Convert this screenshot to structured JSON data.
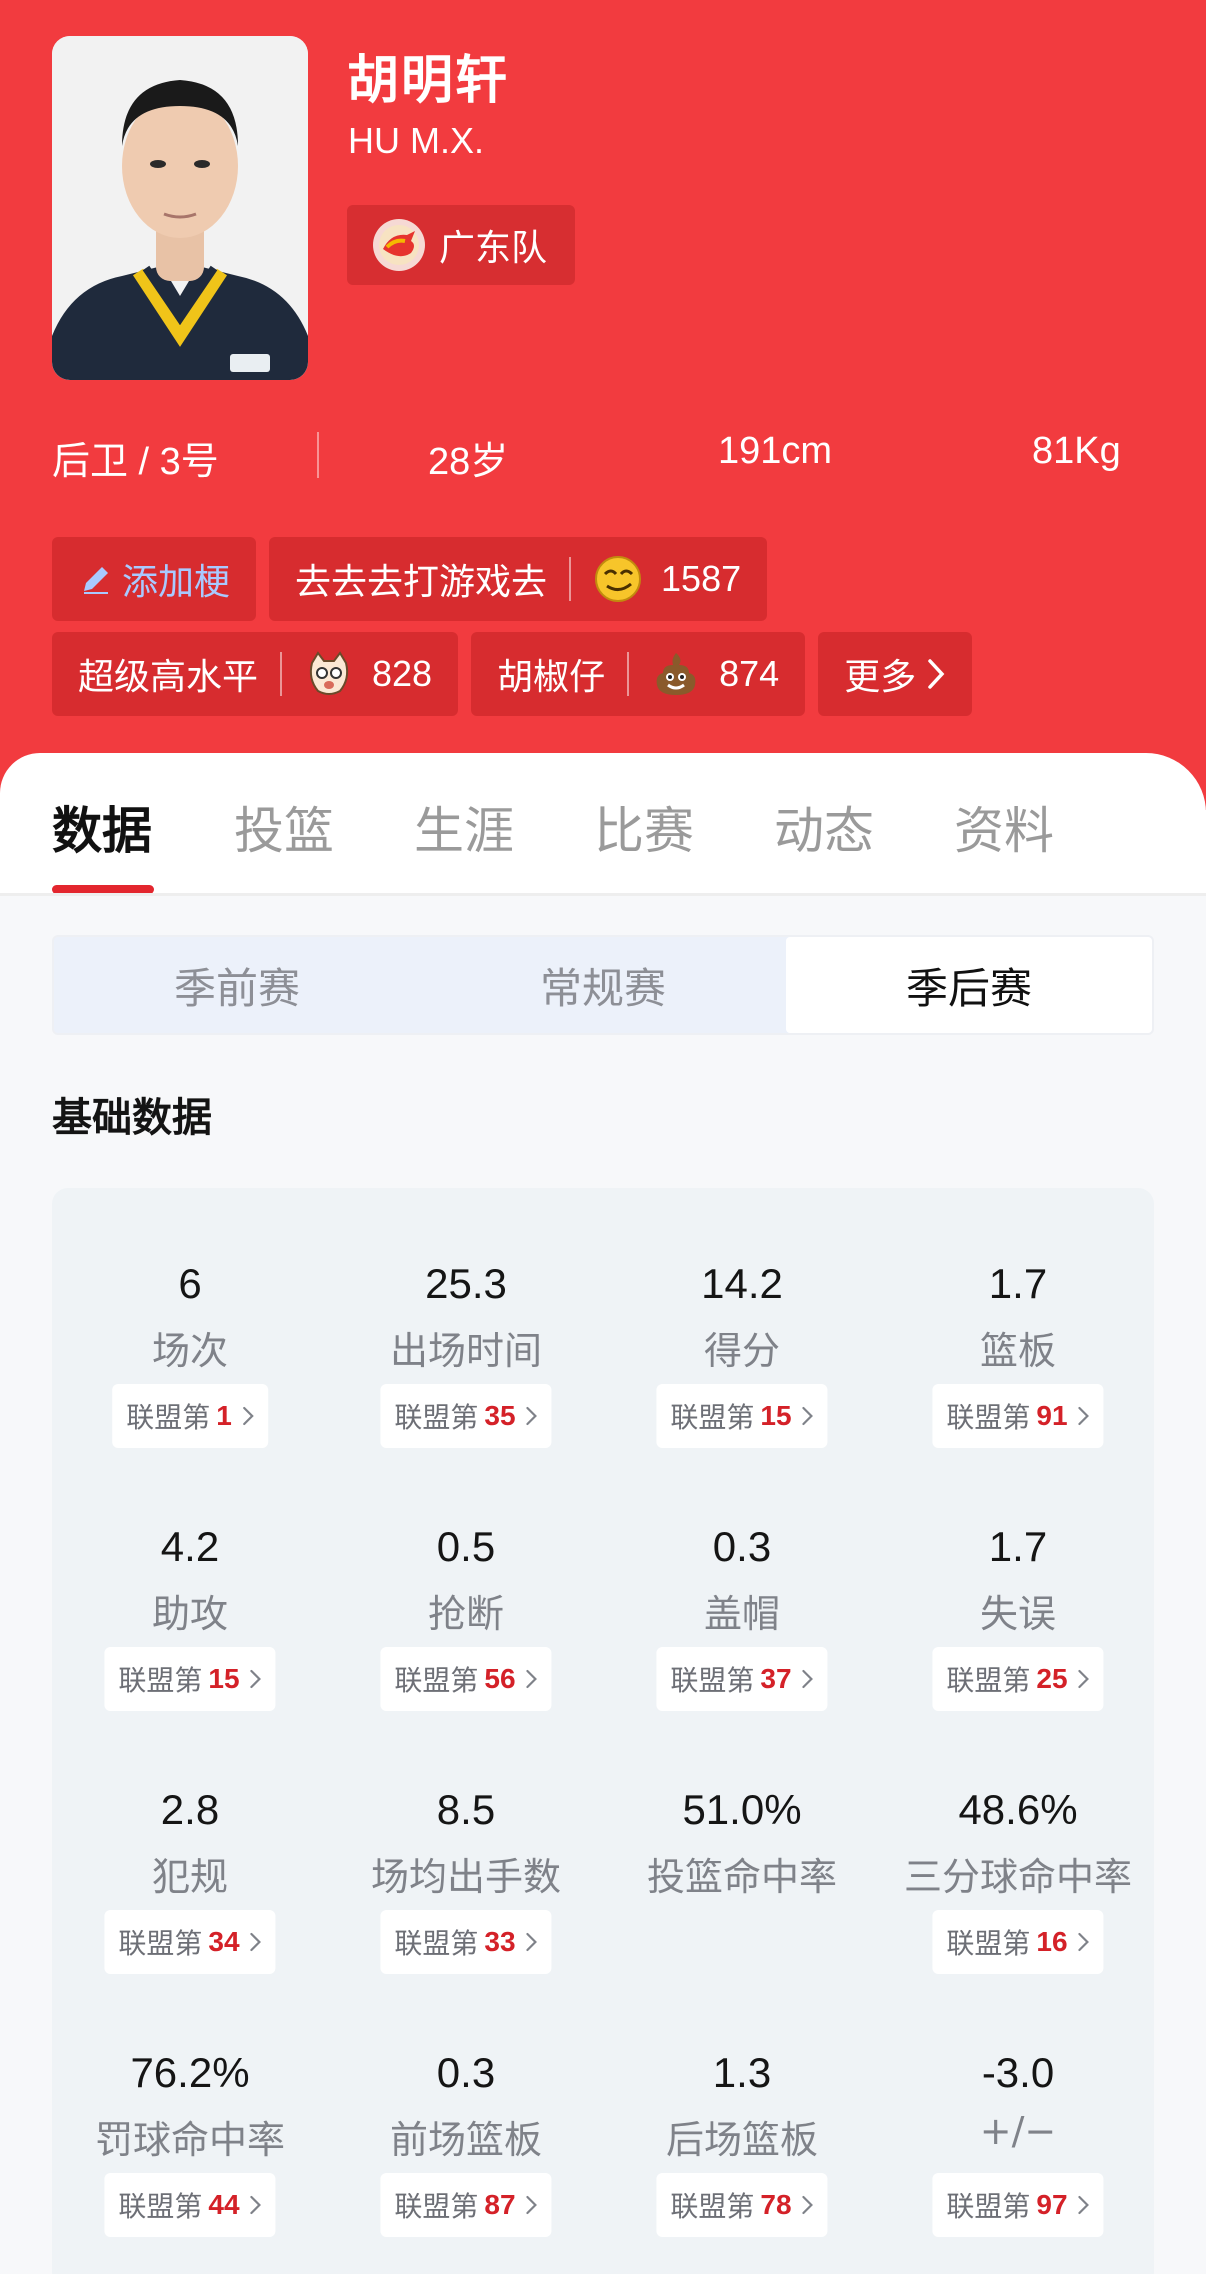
{
  "player": {
    "name_cn": "胡明轩",
    "name_en": "HU M.X.",
    "team": "广东队",
    "position_number": "后卫 / 3号",
    "age": "28岁",
    "height": "191cm",
    "weight": "81Kg"
  },
  "memes": {
    "add_label": "添加梗",
    "row1": [
      {
        "text": "去去去打游戏去",
        "count": "1587",
        "emoji": "smirk-emoji-icon"
      }
    ],
    "row2": [
      {
        "text": "超级高水平",
        "count": "828",
        "emoji": "cat-face-icon"
      },
      {
        "text": "胡椒仔",
        "count": "874",
        "emoji": "poop-emoji-icon"
      }
    ],
    "more_label": "更多"
  },
  "tabs": [
    "数据",
    "投篮",
    "生涯",
    "比赛",
    "动态",
    "资料"
  ],
  "active_tab": "数据",
  "season_types": [
    "季前赛",
    "常规赛",
    "季后赛"
  ],
  "active_season_type": "季后赛",
  "section_title": "基础数据",
  "rank_prefix": "联盟第",
  "stats": [
    {
      "value": "6",
      "label": "场次",
      "rank": "1"
    },
    {
      "value": "25.3",
      "label": "出场时间",
      "rank": "35"
    },
    {
      "value": "14.2",
      "label": "得分",
      "rank": "15"
    },
    {
      "value": "1.7",
      "label": "篮板",
      "rank": "91"
    },
    {
      "value": "4.2",
      "label": "助攻",
      "rank": "15"
    },
    {
      "value": "0.5",
      "label": "抢断",
      "rank": "56"
    },
    {
      "value": "0.3",
      "label": "盖帽",
      "rank": "37"
    },
    {
      "value": "1.7",
      "label": "失误",
      "rank": "25"
    },
    {
      "value": "2.8",
      "label": "犯规",
      "rank": "34"
    },
    {
      "value": "8.5",
      "label": "场均出手数",
      "rank": "33"
    },
    {
      "value": "51.0%",
      "label": "投篮命中率",
      "rank": ""
    },
    {
      "value": "48.6%",
      "label": "三分球命中率",
      "rank": "16"
    },
    {
      "value": "76.2%",
      "label": "罚球命中率",
      "rank": "44"
    },
    {
      "value": "0.3",
      "label": "前场篮板",
      "rank": "87"
    },
    {
      "value": "1.3",
      "label": "后场篮板",
      "rank": "78"
    },
    {
      "value": "-3.0",
      "label": "+/−",
      "rank": "97"
    }
  ],
  "colors": {
    "header_red": "#f23b3f",
    "accent_red": "#e3262e",
    "rank_red": "#d42128",
    "add_meme_blue": "#a9c9ff"
  }
}
